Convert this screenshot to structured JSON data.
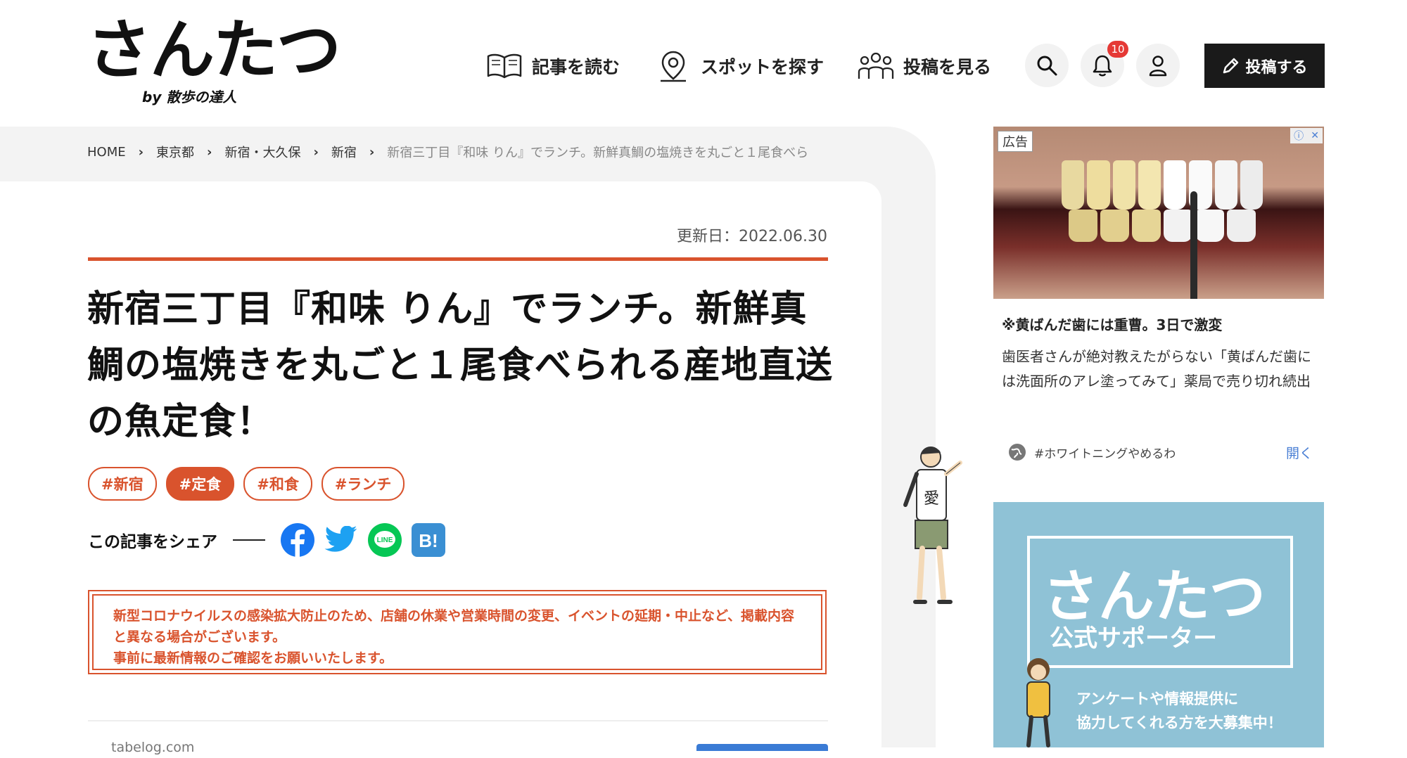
{
  "header": {
    "logo_text": "さんたつ",
    "logo_sub": "by 散歩の達人",
    "nav": [
      {
        "label": "記事を読む"
      },
      {
        "label": "スポットを探す"
      },
      {
        "label": "投稿を見る"
      }
    ],
    "notification_count": "10",
    "post_button_label": "投稿する"
  },
  "breadcrumb": {
    "items": [
      "HOME",
      "東京都",
      "新宿・大久保",
      "新宿"
    ],
    "current": "新宿三丁目『和味 りん』でランチ。新鮮真鯛の塩焼きを丸ごと１尾食べら"
  },
  "article": {
    "updated": "更新日：2022.06.30",
    "title": "新宿三丁目『和味 りん』でランチ。新鮮真鯛の塩焼きを丸ごと１尾食べられる産地直送の魚定食！",
    "tags": [
      "#新宿",
      "#定食",
      "#和食",
      "#ランチ"
    ],
    "share_label": "この記事をシェア",
    "notice_lines": [
      "新型コロナウイルスの感染拡大防止のため、店舗の休業や営業時間の変更、イベントの延期・中止など、掲載内容と異なる場合がございます。",
      "事前に最新情報のご確認をお願いいたします。"
    ],
    "source": "tabelog.com"
  },
  "ads": {
    "label": "広告",
    "title": "※黄ばんだ歯には重曹。3日で激変",
    "desc": "歯医者さんが絶対教えたがらない「黄ばんだ歯には洗面所のアレ塗ってみて」薬局で売り切れ続出",
    "hashtag": "#ホワイトニングやめるわ",
    "open_label": "開く",
    "supporter": {
      "big": "さんたつ",
      "sub": "公式サポーター",
      "line1": "アンケートや情報提供に",
      "line2": "協力してくれる方を大募集中！"
    }
  },
  "colors": {
    "accent": "#d9532d",
    "dark": "#1a1a1a",
    "ad_blue": "#8fc2d6",
    "link_blue": "#4a7fd4"
  }
}
